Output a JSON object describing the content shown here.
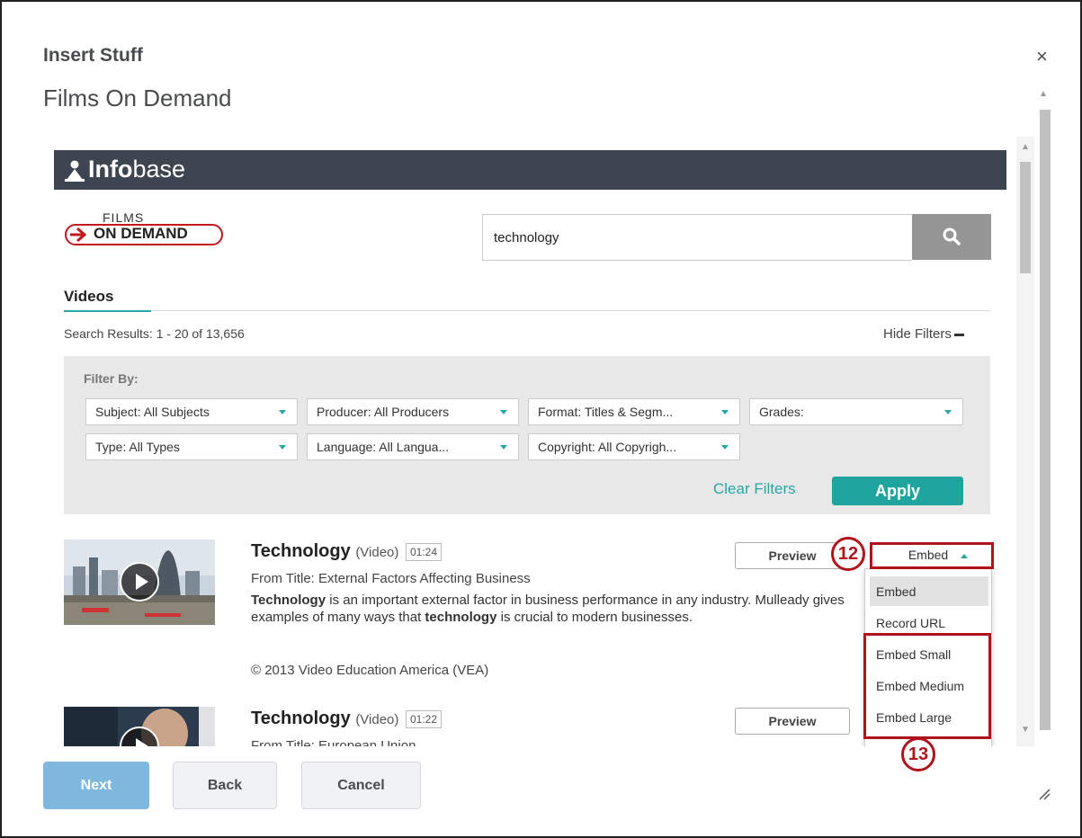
{
  "dialog": {
    "title": "Insert Stuff",
    "subtitle": "Films On Demand",
    "close_glyph": "×"
  },
  "infobase": {
    "brand_bold": "Info",
    "brand_rest": "base"
  },
  "fod_logo": {
    "films": "FILMS",
    "on_demand": "ON DEMAND"
  },
  "search": {
    "value": "technology",
    "button_icon": "search-icon"
  },
  "tabs": [
    {
      "label": "Videos",
      "active": true
    }
  ],
  "results_summary": "Search Results: 1 - 20 of 13,656",
  "hide_filters_label": "Hide Filters",
  "filters": {
    "label": "Filter By:",
    "selects": [
      {
        "value": "Subject: All Subjects"
      },
      {
        "value": "Producer: All Producers"
      },
      {
        "value": "Format: Titles & Segm..."
      },
      {
        "value": "Grades:"
      },
      {
        "value": "Type: All Types"
      },
      {
        "value": "Language: All Langua..."
      },
      {
        "value": "Copyright: All Copyrigh..."
      }
    ],
    "clear_label": "Clear Filters",
    "apply_label": "Apply"
  },
  "results": [
    {
      "title": "Technology",
      "kind": "(Video)",
      "duration": "01:24",
      "from_title": "From Title: External Factors Affecting Business",
      "description_parts": [
        {
          "text": "Technology",
          "bold": true
        },
        {
          "text": " is an important external factor in business performance in any industry. Mulleady gives examples of many ways that ",
          "bold": false
        },
        {
          "text": "technology",
          "bold": true
        },
        {
          "text": " is crucial to modern businesses.",
          "bold": false
        }
      ],
      "copyright": "© 2013 Video Education America (VEA)",
      "preview_label": "Preview",
      "embed_label": "Embed"
    },
    {
      "title": "Technology",
      "kind": "(Video)",
      "duration": "01:22",
      "from_title": "From Title: European Union",
      "preview_label": "Preview"
    }
  ],
  "embed_menu": {
    "items": [
      "Embed",
      "Record URL",
      "Embed Small",
      "Embed Medium",
      "Embed Large"
    ],
    "active_index": 0
  },
  "annotations": {
    "callout_12": "12",
    "callout_13": "13",
    "color": "#b0141a"
  },
  "footer": {
    "next": "Next",
    "back": "Back",
    "cancel": "Cancel"
  },
  "colors": {
    "accent_teal": "#1fa59e",
    "infobase_bar": "#3d4550",
    "next_button": "#7eb8df",
    "brand_red": "#c4161c"
  }
}
